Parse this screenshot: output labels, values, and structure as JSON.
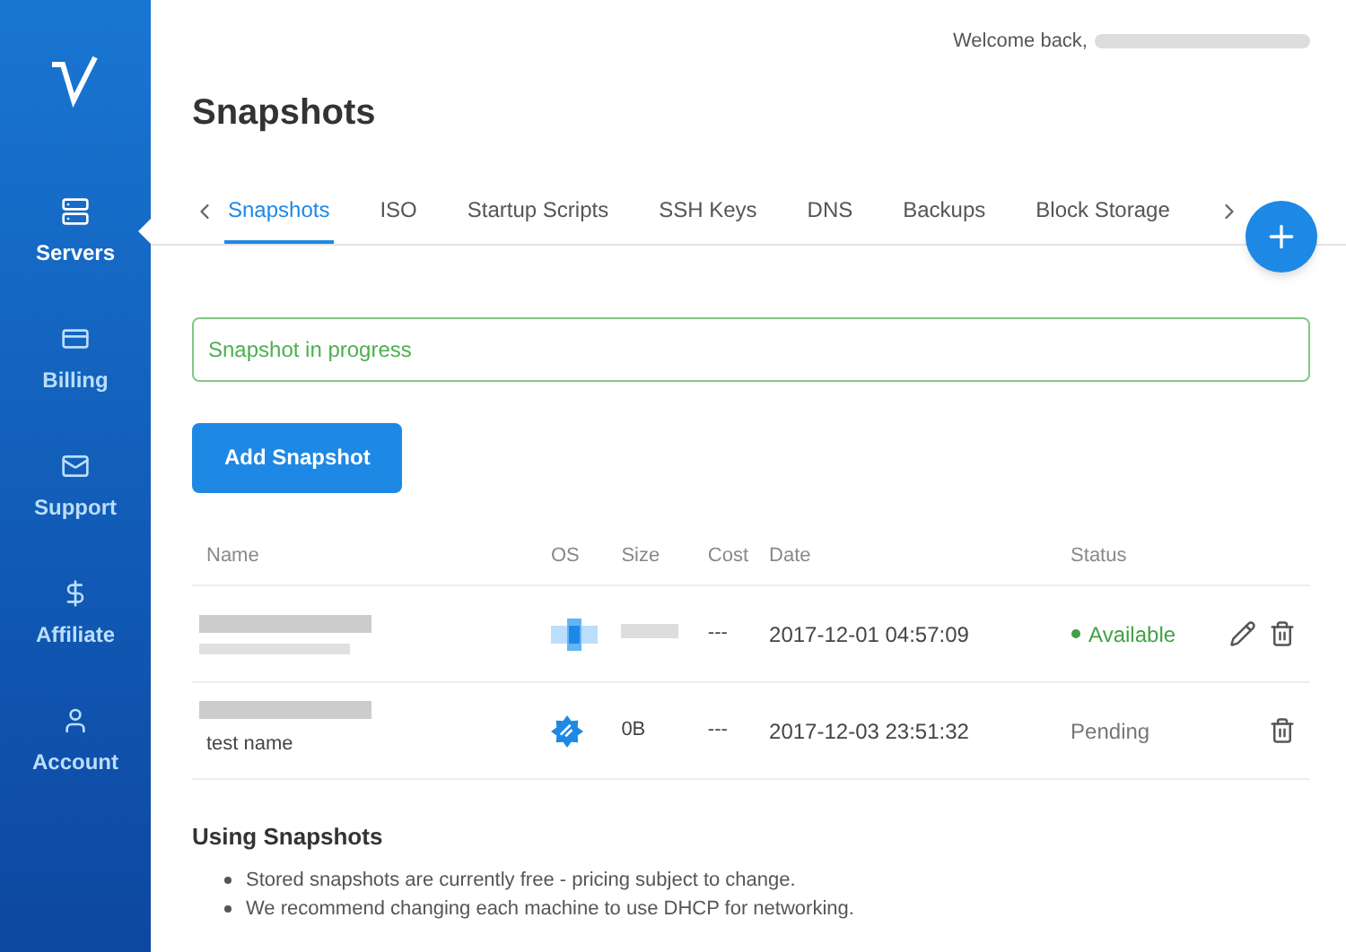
{
  "sidebar": {
    "items": [
      {
        "label": "Servers",
        "selected": true
      },
      {
        "label": "Billing",
        "selected": false
      },
      {
        "label": "Support",
        "selected": false
      },
      {
        "label": "Affiliate",
        "selected": false
      },
      {
        "label": "Account",
        "selected": false
      }
    ]
  },
  "header": {
    "welcome": "Welcome back,"
  },
  "page_title": "Snapshots",
  "tabs": [
    {
      "label": "Snapshots",
      "selected": true
    },
    {
      "label": "ISO",
      "selected": false
    },
    {
      "label": "Startup Scripts",
      "selected": false
    },
    {
      "label": "SSH Keys",
      "selected": false
    },
    {
      "label": "DNS",
      "selected": false
    },
    {
      "label": "Backups",
      "selected": false
    },
    {
      "label": "Block Storage",
      "selected": false
    }
  ],
  "notice": "Snapshot in progress",
  "add_button": "Add Snapshot",
  "table": {
    "columns": [
      "Name",
      "OS",
      "Size",
      "Cost",
      "Date",
      "Status"
    ],
    "rows": [
      {
        "kind": "blurred",
        "cost": "---",
        "date": "2017-12-01 04:57:09",
        "status": "Available",
        "color": "#43a047",
        "editable": true
      },
      {
        "kind": "named",
        "description": "test name",
        "size": "0B",
        "cost": "---",
        "date": "2017-12-03 23:51:32",
        "status": "Pending",
        "editable": false
      }
    ]
  },
  "info": {
    "title": "Using Snapshots",
    "bullets": [
      "Stored snapshots are currently free - pricing subject to change.",
      "We recommend changing each machine to use DHCP for networking."
    ]
  }
}
